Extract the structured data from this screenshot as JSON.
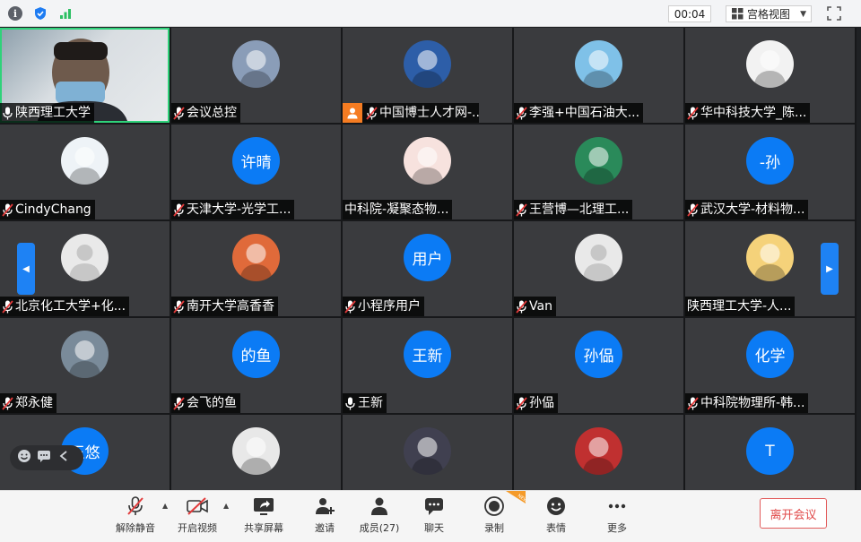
{
  "topbar": {
    "info_icon": "i",
    "timer": "00:04",
    "view_label": "宫格视图"
  },
  "colors": {
    "accent_blue": "#0b7bf5",
    "active_speaker_border": "#2fd27a",
    "leave_red": "#e04848",
    "tile_bg": "#3a3b3e"
  },
  "participants": [
    {
      "name": "陕西理工大学",
      "avatar": "video",
      "mic": "active"
    },
    {
      "name": "会议总控",
      "avatar": "photo",
      "mic": "muted"
    },
    {
      "name": "中国博士人才网-...",
      "avatar": "photo",
      "mic": "muted",
      "host": true
    },
    {
      "name": "李强+中国石油大...",
      "avatar": "photo",
      "mic": "muted"
    },
    {
      "name": "华中科技大学_陈...",
      "avatar": "photo",
      "mic": "muted"
    },
    {
      "name": "CindyChang",
      "avatar": "photo",
      "mic": "muted"
    },
    {
      "name": "天津大学-光学工...",
      "avatar_text": "许晴",
      "mic": "muted"
    },
    {
      "name": "中科院-凝聚态物...",
      "avatar": "photo",
      "mic": "none"
    },
    {
      "name": "王营博—北理工...",
      "avatar": "photo",
      "mic": "muted"
    },
    {
      "name": "武汉大学-材料物...",
      "avatar_text": "-孙",
      "mic": "muted"
    },
    {
      "name": "北京化工大学+化...",
      "avatar": "default",
      "mic": "muted"
    },
    {
      "name": "南开大学高香香",
      "avatar": "photo",
      "mic": "muted"
    },
    {
      "name": "小程序用户",
      "avatar_text": "用户",
      "mic": "muted"
    },
    {
      "name": "Van",
      "avatar": "default",
      "mic": "muted"
    },
    {
      "name": "陕西理工大学-人...",
      "avatar": "photo",
      "mic": "none"
    },
    {
      "name": "郑永健",
      "avatar": "photo",
      "mic": "muted"
    },
    {
      "name": "会飞的鱼",
      "avatar_text": "的鱼",
      "mic": "muted"
    },
    {
      "name": "王新",
      "avatar_text": "王新",
      "mic": "active"
    },
    {
      "name": "孙偘",
      "avatar_text": "孙偘",
      "mic": "muted"
    },
    {
      "name": "中科院物理所-韩...",
      "avatar_text": "化学",
      "mic": "muted"
    },
    {
      "name": "",
      "avatar_text": "王悠",
      "mic": "none"
    },
    {
      "name": "",
      "avatar": "photo",
      "mic": "none"
    },
    {
      "name": "",
      "avatar": "photo",
      "mic": "none"
    },
    {
      "name": "",
      "avatar": "photo",
      "mic": "none"
    },
    {
      "name": "",
      "avatar_text": "T",
      "mic": "none"
    }
  ],
  "toolbar": {
    "mute": "解除静音",
    "video": "开启视频",
    "share": "共享屏幕",
    "invite": "邀请",
    "members": "成员(27)",
    "chat": "聊天",
    "record": "录制",
    "reaction": "表情",
    "more": "更多",
    "leave": "离开会议",
    "new_tag": "NEW"
  }
}
